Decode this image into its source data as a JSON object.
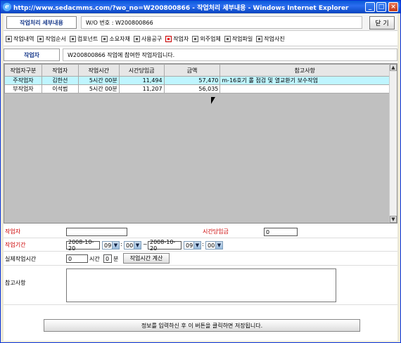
{
  "window": {
    "title": "http://www.sedacmms.com/?wo_no=W200800866 - 작업처리 세부내용 - Windows Internet Explorer"
  },
  "header": {
    "title": "작업처리 세부내용",
    "wo_label": "W/O 번호 : W200800866",
    "close_button": "닫 기"
  },
  "tabs": [
    {
      "label": "작업내역",
      "active": false
    },
    {
      "label": "작업순서",
      "active": false
    },
    {
      "label": "컴포넌트",
      "active": false
    },
    {
      "label": "소요자재",
      "active": false
    },
    {
      "label": "사용공구",
      "active": false
    },
    {
      "label": "작업자",
      "active": true
    },
    {
      "label": "외주업체",
      "active": false
    },
    {
      "label": "작업파일",
      "active": false
    },
    {
      "label": "작업사진",
      "active": false
    }
  ],
  "section": {
    "label": "작업자",
    "description": "W200800866 작업에 참여한 작업자입니다."
  },
  "grid": {
    "columns": [
      "작업자구분",
      "작업자",
      "작업시간",
      "시간당임금",
      "금액",
      "참고사항"
    ],
    "rows": [
      [
        "주작업자",
        "김한선",
        "5시간 00분",
        "11,494",
        "57,470",
        "m-16호기 롤 점검 및 열교환기 보수작업"
      ],
      [
        "부작업자",
        "이석범",
        "5시간 00분",
        "11,207",
        "56,035",
        ""
      ]
    ]
  },
  "form": {
    "worker_label": "작업자",
    "worker_value": "",
    "hourly_wage_label": "시간당임금",
    "hourly_wage_value": "0",
    "period_label": "작업기간",
    "start_date": "2008-10-20",
    "start_hour": "09",
    "start_min": "00",
    "tilde": "~",
    "end_date": "2008-10-20",
    "end_hour": "09",
    "end_min": "00",
    "colon": ":",
    "actual_time_label": "실제작업시간",
    "actual_hours": "0",
    "hours_unit": "시간",
    "actual_minutes": "0",
    "minutes_unit": "분",
    "calc_button": "작업시간 계산",
    "notes_label": "참고사항",
    "notes_value": "",
    "submit_button": "정보를 입력하신 후 이 버튼을 클릭하면 저장됩니다."
  },
  "colors": {
    "accent": "#1b3c8c",
    "required_label": "#cc0000",
    "selected_row": "#bff5ff"
  }
}
